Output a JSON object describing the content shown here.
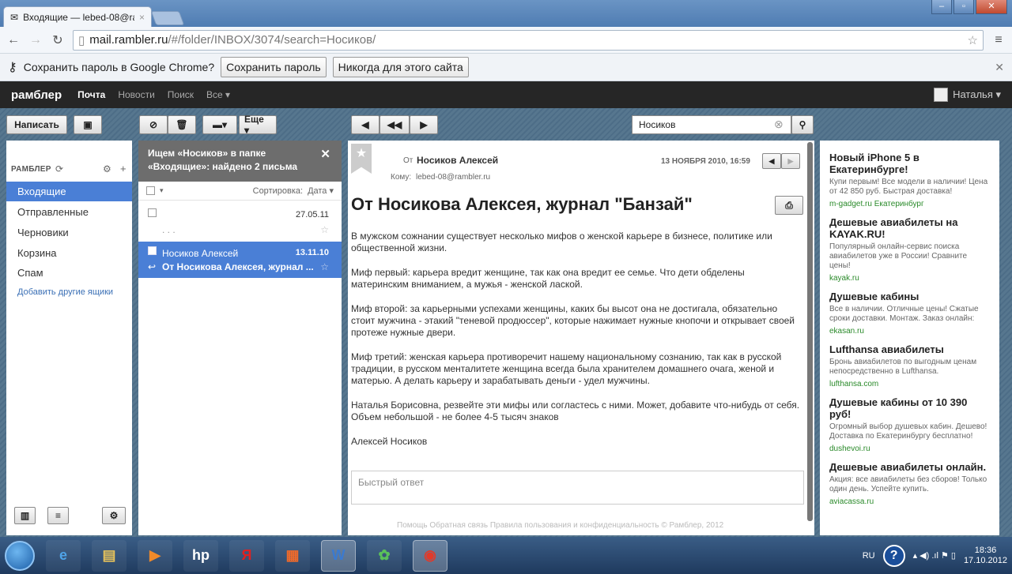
{
  "browser": {
    "tab_title": "Входящие — lebed-08@ra",
    "url_host": "mail.rambler.ru",
    "url_path": "/#/folder/INBOX/3074/search=Носиков/",
    "pw_prompt": "Сохранить пароль в Google Chrome?",
    "pw_save": "Сохранить пароль",
    "pw_never": "Никогда для этого сайта"
  },
  "header": {
    "logo": "рамблер",
    "nav": [
      "Почта",
      "Новости",
      "Поиск",
      "Все ▾"
    ],
    "user": "Наталья ▾"
  },
  "toolbar": {
    "compose": "Написать",
    "more": "Еще ▾",
    "search_value": "Носиков"
  },
  "sidebar": {
    "title": "РАМБЛЕР",
    "folders": [
      "Входящие",
      "Отправленные",
      "Черновики",
      "Корзина",
      "Спам"
    ],
    "add_boxes": "Добавить другие ящики"
  },
  "list": {
    "search_line1": "Ищем «Носиков» в папке",
    "search_line2": "«Входящие»: найдено 2 письма",
    "sort_label": "Сортировка:",
    "sort_value": "Дата ▾",
    "messages": [
      {
        "from": "",
        "date": "27.05.11",
        "subject": ". . ."
      },
      {
        "from": "Носиков Алексей",
        "date": "13.11.10",
        "subject": "От Носикова Алексея, журнал ..."
      }
    ]
  },
  "reader": {
    "from_label": "От",
    "from": "Носиков Алексей",
    "date": "13 НОЯБРЯ 2010, 16:59",
    "to_label": "Кому:",
    "to": "lebed-08@rambler.ru",
    "subject": "От Носикова Алексея, журнал \"Банзай\"",
    "body": [
      "В мужском сожнании существует несколько мифов о женской карьере в бизнесе, политике или общественной жизни.",
      "Миф первый: карьера вредит женщине, так как она вредит ее семье. Что дети обделены материнским вниманием, а мужья - женской лаской.",
      "Миф второй: за карьерными успехами женщины, каких бы высот она не достигала, обязательно стоит мужчина - этакий \"теневой продюссер\", которые нажимает нужные кнопочи и открывает своей протеже нужные двери.",
      "Миф третий: женская карьера противоречит нашему национальному сознанию, так как в русской традиции, в русском менталитете женщина всегда была хранителем домашнего очага, женой и матерью. А делать карьеру и зарабатывать деньги - удел мужчины.",
      "Наталья Борисовна, резвейте эти мифы или согластесь с ними. Может, добавите что-нибудь от себя. Объем небольшой - не более 4-5 тысяч знаков",
      "Алексей Носиков"
    ],
    "quick_reply": "Быстрый ответ",
    "footer": "Помощь  Обратная связь  Правила пользования и конфиденциальность  © Рамблер, 2012"
  },
  "ads": [
    {
      "title": "Новый iPhone 5 в Екатеринбурге!",
      "desc": "Купи первым! Все модели в наличии! Цена от 42 850 руб. Быстрая доставка!",
      "link": "m-gadget.ru Екатеринбург"
    },
    {
      "title": "Дешевые авиабилеты на KAYAK.RU!",
      "desc": "Популярный онлайн-сервис поиска авиабилетов уже в России! Сравните цены!",
      "link": "kayak.ru"
    },
    {
      "title": "Душевые кабины",
      "desc": "Все в наличии. Отличные цены! Сжатые сроки доставки. Монтаж. Заказ онлайн:",
      "link": "ekasan.ru"
    },
    {
      "title": "Lufthansa авиабилеты",
      "desc": "Бронь авиабилетов по выгодным ценам непосредственно в Lufthansa.",
      "link": "lufthansa.com"
    },
    {
      "title": "Душевые кабины от 10 390 руб!",
      "desc": "Огромный выбор душевых кабин. Дешево! Доставка по Екатеринбургу бесплатно!",
      "link": "dushevoi.ru"
    },
    {
      "title": "Дешевые авиабилеты онлайн.",
      "desc": "Акция: все авиабилеты без сборов! Только один день. Успейте купить.",
      "link": "aviacassa.ru"
    }
  ],
  "taskbar": {
    "lang": "RU",
    "time": "18:36",
    "date": "17.10.2012"
  }
}
